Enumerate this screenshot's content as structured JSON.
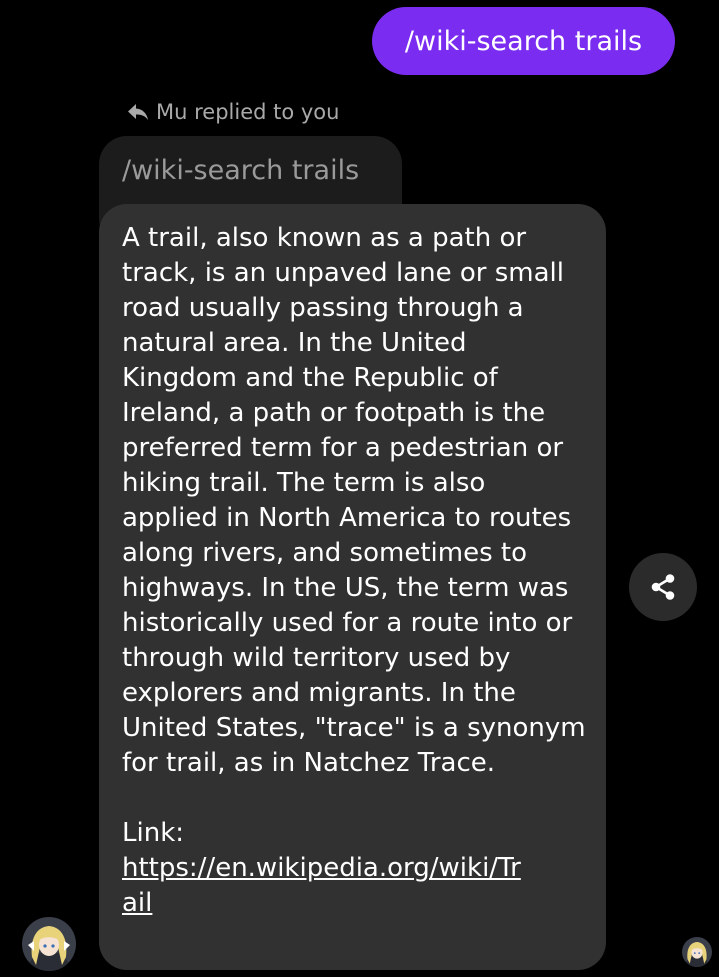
{
  "sent_message": {
    "text": "/wiki-search trails",
    "bubble_color": "#7a2cf0"
  },
  "reply": {
    "meta_text": "Mu replied to you",
    "icon": "reply-arrow-icon",
    "quoted_text": "/wiki-search trails",
    "body_text": "A trail, also known as a path or track, is an unpaved lane or small road usually passing through a natural area. In the United Kingdom and the Republic of Ireland, a path or footpath is the preferred term for a pedestrian or hiking trail. The term is also applied in North America to routes along rivers, and sometimes to highways. In the US, the term was historically used for a route into or through wild territory used by explorers and migrants. In the United States, \"trace\" is a synonym for trail, as in Natchez Trace.",
    "link_label": "Link:",
    "link_url": "https://en.wikipedia.org/wiki/Trail",
    "bubble_color": "#313131"
  },
  "actions": {
    "share_icon": "share-icon"
  },
  "avatars": {
    "sender_avatar": "anime-character-avatar",
    "read_receipt_avatar": "anime-character-avatar"
  }
}
